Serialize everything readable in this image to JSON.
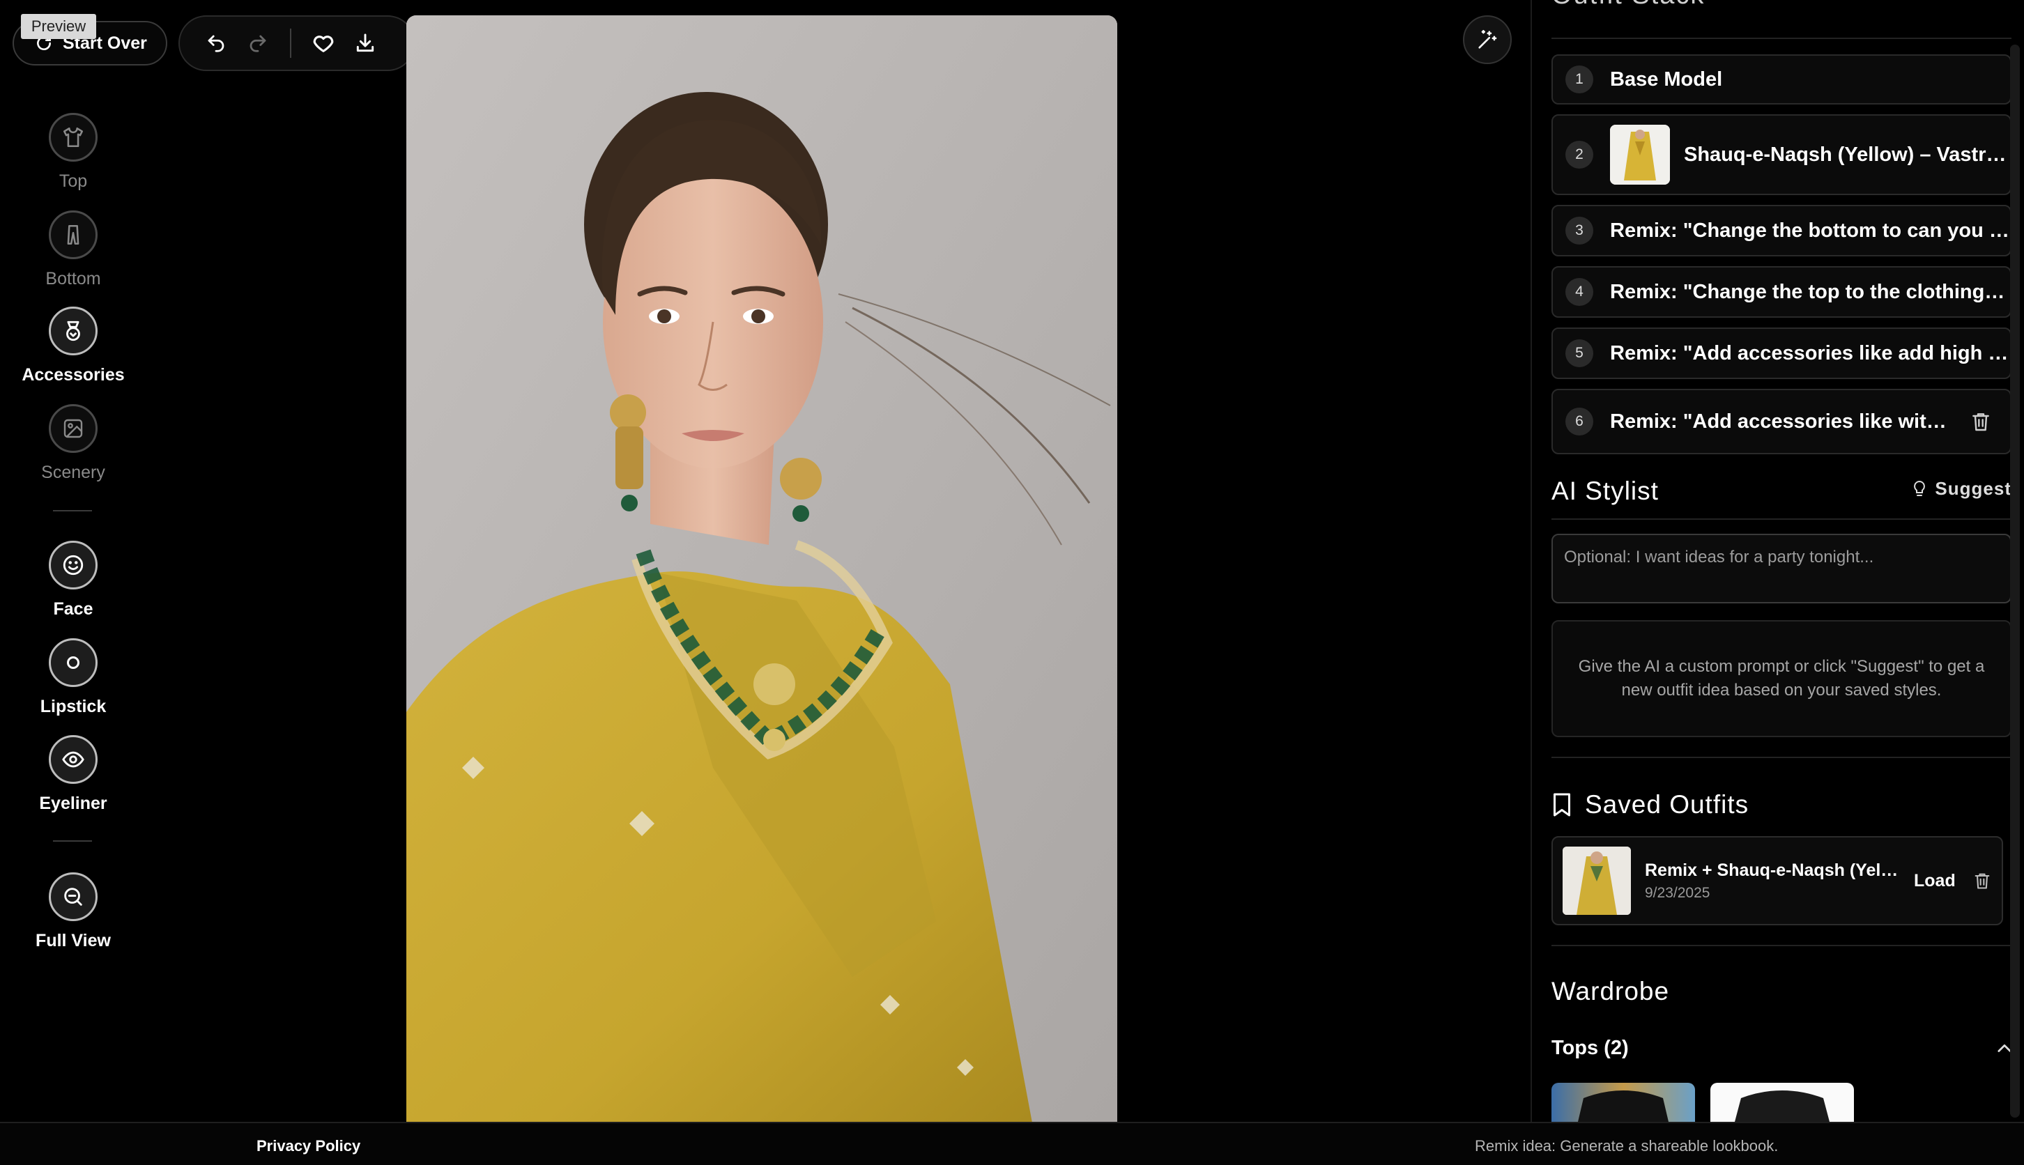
{
  "preview_tag": "Preview",
  "start_over_label": "Start Over",
  "rail": {
    "items": [
      {
        "label": "Top",
        "icon": "shirt-icon"
      },
      {
        "label": "Bottom",
        "icon": "pants-icon"
      },
      {
        "label": "Accessories",
        "icon": "gem-icon"
      },
      {
        "label": "Scenery",
        "icon": "image-icon"
      },
      {
        "label": "Face",
        "icon": "smile-icon"
      },
      {
        "label": "Lipstick",
        "icon": "lipstick-icon"
      },
      {
        "label": "Eyeliner",
        "icon": "eye-icon"
      },
      {
        "label": "Full View",
        "icon": "zoom-out-icon"
      }
    ],
    "active_items": [
      "Accessories",
      "Face",
      "Lipstick",
      "Eyeliner",
      "Full View"
    ]
  },
  "outfit_stack": {
    "title": "Outfit Stack",
    "items": [
      {
        "num": "1",
        "text": "Base Model"
      },
      {
        "num": "2",
        "text": "Shauq-e-Naqsh (Yellow) – Vastra Ensemble"
      },
      {
        "num": "3",
        "text": "Remix: \"Change the bottom to can you make the"
      },
      {
        "num": "4",
        "text": "Remix: \"Change the top to the clothing item in"
      },
      {
        "num": "5",
        "text": "Remix: \"Add accessories like add high heels"
      },
      {
        "num": "6",
        "text": "Remix: \"Add accessories like with jewelry"
      }
    ]
  },
  "ai_stylist": {
    "title": "AI Stylist",
    "suggest_label": "Suggest",
    "placeholder": "Optional: I want ideas for a party tonight...",
    "hint": "Give the AI a custom prompt or click \"Suggest\" to get a new outfit idea based on your saved styles."
  },
  "saved_outfits": {
    "title": "Saved Outfits",
    "items": [
      {
        "name": "Remix + Shauq-e-Naqsh (Yellow)",
        "date": "9/23/2025",
        "load_label": "Load"
      }
    ]
  },
  "wardrobe": {
    "title": "Wardrobe",
    "categories": [
      {
        "label": "Tops (2)"
      }
    ]
  },
  "footer": {
    "privacy_label": "Privacy Policy",
    "tip": "Remix idea: Generate a shareable lookbook."
  },
  "colors": {
    "background": "#000000",
    "garment_yellow": "#c9a92b",
    "photo_backdrop": "#bbb7b5"
  }
}
